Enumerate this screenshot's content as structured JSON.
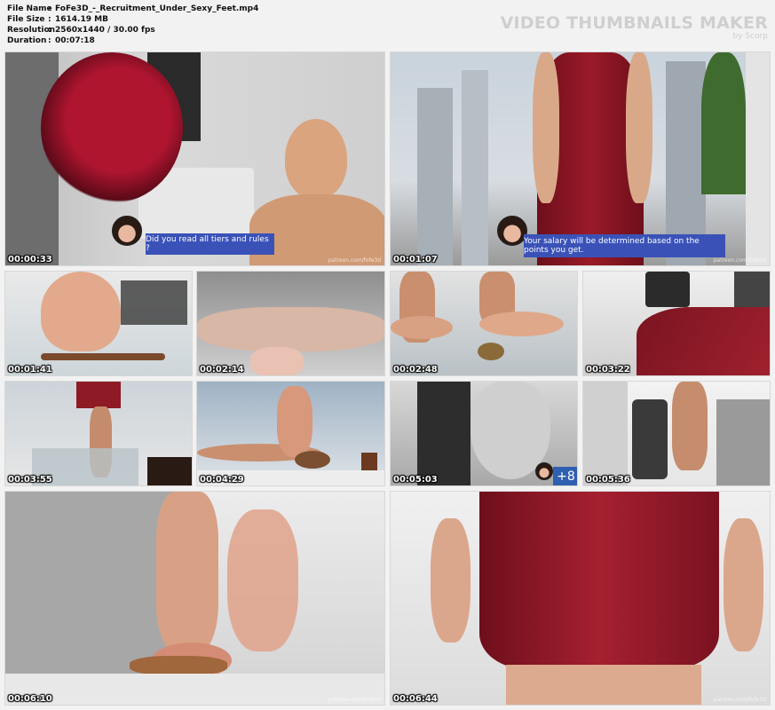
{
  "file_info": {
    "rows": [
      {
        "label": "File Name",
        "value": "FoFe3D_-_Recruitment_Under_Sexy_Feet.mp4"
      },
      {
        "label": "File Size",
        "value": "1614.19 MB"
      },
      {
        "label": "Resolution",
        "value": "2560x1440 / 30.00 fps"
      },
      {
        "label": "Duration",
        "value": "00:07:18"
      }
    ],
    "separator": ":"
  },
  "brand": {
    "title": "VIDEO THUMBNAILS MAKER",
    "subtitle": "by Scorp"
  },
  "watermark": "patreon.com/fofe3d",
  "thumbnails": [
    {
      "timestamp": "00:00:33",
      "subtitle": "Did you read all tiers and rules ?"
    },
    {
      "timestamp": "00:01:07",
      "subtitle": "Your salary will be determined based on the points you get."
    },
    {
      "timestamp": "00:01:41"
    },
    {
      "timestamp": "00:02:14"
    },
    {
      "timestamp": "00:02:48"
    },
    {
      "timestamp": "00:03:22"
    },
    {
      "timestamp": "00:03:55"
    },
    {
      "timestamp": "00:04:29"
    },
    {
      "timestamp": "00:05:03",
      "badge": "+8"
    },
    {
      "timestamp": "00:05:36"
    },
    {
      "timestamp": "00:06:10"
    },
    {
      "timestamp": "00:06:44"
    }
  ]
}
